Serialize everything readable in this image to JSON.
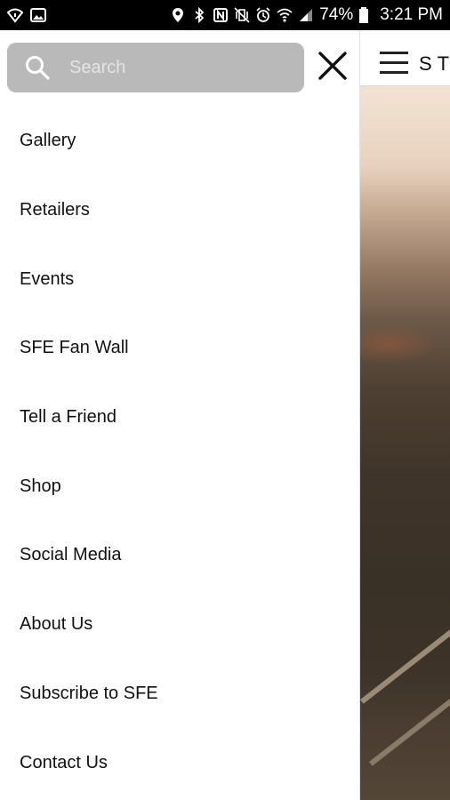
{
  "status_bar": {
    "battery": "74%",
    "time": "3:21 PM"
  },
  "search": {
    "placeholder": "Search"
  },
  "menu": {
    "items": [
      {
        "label": "Gallery"
      },
      {
        "label": "Retailers"
      },
      {
        "label": "Events"
      },
      {
        "label": "SFE Fan Wall"
      },
      {
        "label": "Tell a Friend"
      },
      {
        "label": "Shop"
      },
      {
        "label": "Social Media"
      },
      {
        "label": "About Us"
      },
      {
        "label": "Subscribe to SFE"
      },
      {
        "label": "Contact Us"
      }
    ]
  },
  "background_app": {
    "brand_partial": "STA"
  },
  "colors": {
    "search_bg": "#b9b9b9",
    "drawer_bg": "#ffffff",
    "status_bar_bg": "#000000"
  }
}
